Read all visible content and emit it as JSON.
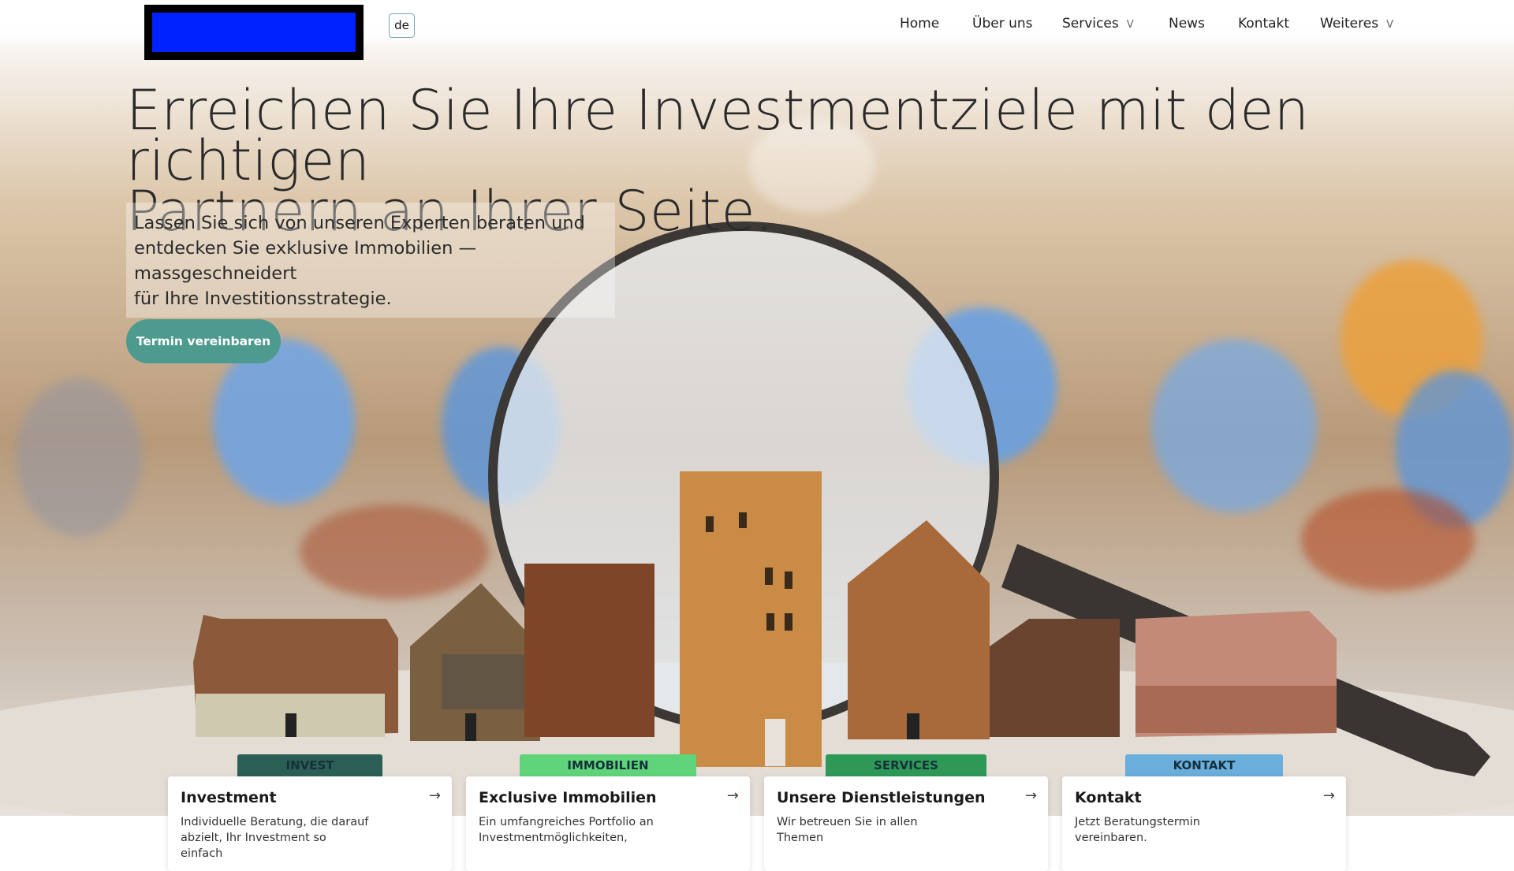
{
  "header": {
    "logo_name": "site-logo",
    "language": "de",
    "nav": [
      {
        "label": "Home",
        "icon": ""
      },
      {
        "label": "Über uns",
        "icon": ""
      },
      {
        "label": "Services",
        "icon": "V"
      },
      {
        "label": "News",
        "icon": ""
      },
      {
        "label": "Kontakt",
        "icon": ""
      },
      {
        "label": "Weiteres",
        "icon": "V"
      }
    ]
  },
  "hero": {
    "title_line1": "Erreichen Sie Ihre Investmentziele mit den richtigen",
    "title_line2": "Partnern an Ihrer Seite.",
    "subtitle_line1": "Lassen Sie sich von unseren Experten beraten und",
    "subtitle_line2": "entdecken Sie exklusive Immobilien — massgeschneidert",
    "subtitle_line3": "für Ihre Investitionsstrategie.",
    "cta_label": "Termin vereinbaren",
    "image_subject": "magnifying-glass-over-wooden-houses"
  },
  "cards": [
    {
      "tag": "INVEST",
      "tag_color": "#2b5f55",
      "title": "Investment",
      "text": "Individuelle Beratung, die darauf abzielt, Ihr Investment so einfach",
      "arrow": "→"
    },
    {
      "tag": "IMMOBILIEN",
      "tag_color": "#5fd47a",
      "title": "Exclusive Immobilien",
      "text": "Ein umfangreiches Portfolio an Investmentmöglichkeiten,",
      "arrow": "→"
    },
    {
      "tag": "SERVICES",
      "tag_color": "#2e9957",
      "title": "Unsere Dienstleistungen",
      "text": "Wir betreuen Sie in allen Themen",
      "arrow": "→"
    },
    {
      "tag": "KONTAKT",
      "tag_color": "#6aaedb",
      "title": "Kontakt",
      "text": "Jetzt Beratungstermin vereinbaren.",
      "arrow": "→"
    }
  ]
}
